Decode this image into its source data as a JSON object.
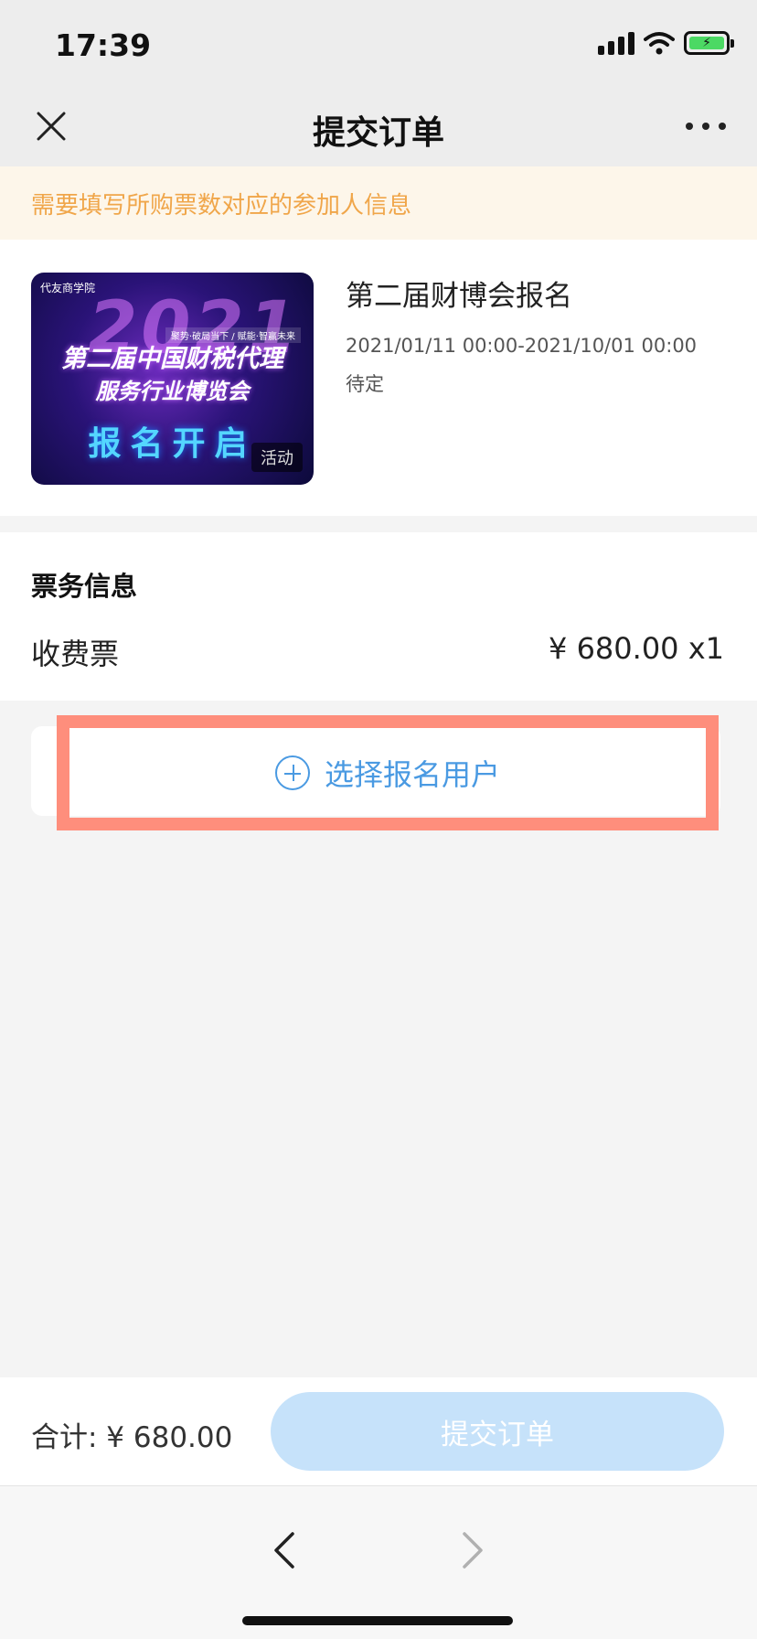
{
  "status_bar": {
    "time": "17:39"
  },
  "nav": {
    "title": "提交订单"
  },
  "notice": {
    "text": "需要填写所购票数对应的参加人信息"
  },
  "event": {
    "poster": {
      "logo_text": "代友商学院",
      "slogan": "聚势·破局当下 / 赋能·智赢未来",
      "year_graphic": "2021",
      "line1": "第二届中国财税代理",
      "line2": "服务行业博览会",
      "line3": "报名开启",
      "tag": "活动"
    },
    "title": "第二届财博会报名",
    "date_range": "2021/01/11 00:00-2021/10/01 00:00",
    "location": "待定"
  },
  "ticket": {
    "heading": "票务信息",
    "name": "收费票",
    "price": "¥ 680.00 x1"
  },
  "select_user": {
    "label": "选择报名用户"
  },
  "footer": {
    "total": "合计: ¥ 680.00",
    "submit_label": "提交订单"
  },
  "colors": {
    "accent": "#4a9ae2",
    "notice_text": "#f0a64a",
    "notice_bg": "#fdf6ea",
    "highlight": "#fe8e7c",
    "submit_disabled": "#c6e2fa"
  }
}
